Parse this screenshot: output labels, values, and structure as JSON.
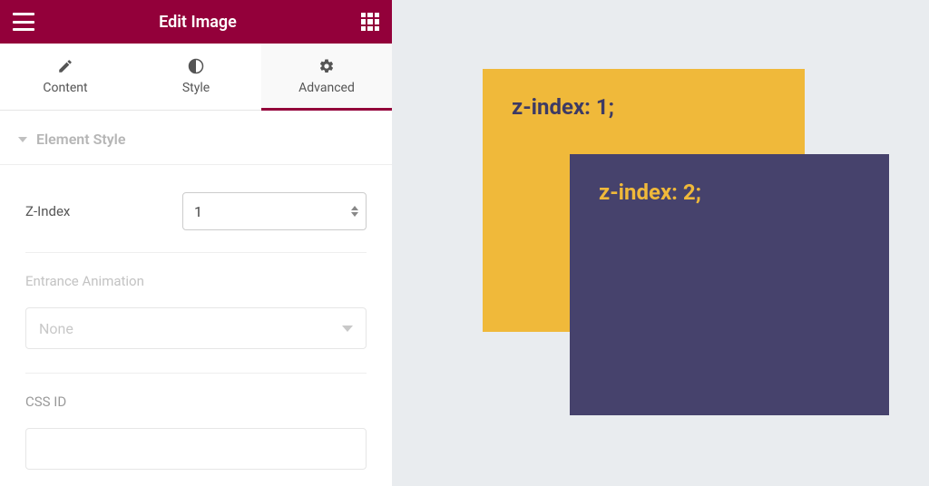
{
  "header": {
    "title": "Edit Image"
  },
  "tabs": {
    "content": "Content",
    "style": "Style",
    "advanced": "Advanced"
  },
  "section": {
    "title": "Element Style"
  },
  "fields": {
    "zindex_label": "Z-Index",
    "zindex_value": "1",
    "entrance_label": "Entrance Animation",
    "entrance_value": "None",
    "cssid_label": "CSS ID"
  },
  "preview": {
    "box1": "z-index: 1;",
    "box2": "z-index: 2;"
  }
}
